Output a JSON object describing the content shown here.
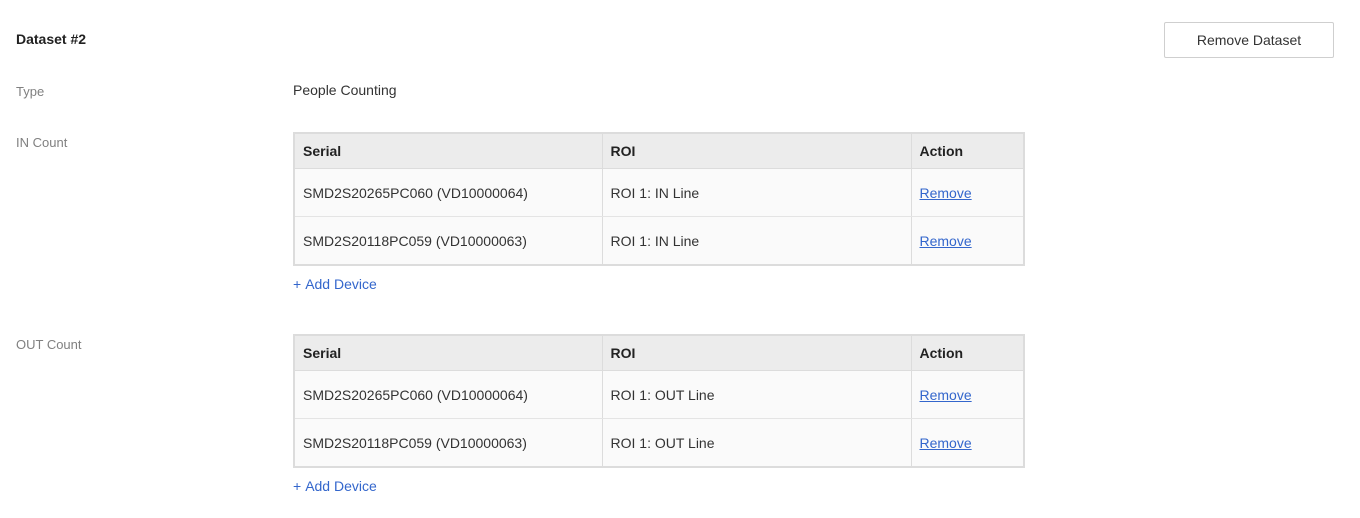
{
  "dataset": {
    "title": "Dataset #2",
    "remove_button": "Remove Dataset"
  },
  "type": {
    "label": "Type",
    "value": "People Counting"
  },
  "table_headers": {
    "serial": "Serial",
    "roi": "ROI",
    "action": "Action"
  },
  "in_count": {
    "label": "IN Count",
    "rows": [
      {
        "serial": "SMD2S20265PC060 (VD10000064)",
        "roi": "ROI 1: IN Line",
        "action": "Remove"
      },
      {
        "serial": "SMD2S20118PC059 (VD10000063)",
        "roi": "ROI 1: IN Line",
        "action": "Remove"
      }
    ],
    "add_device_plus": "+",
    "add_device_label": "Add Device"
  },
  "out_count": {
    "label": "OUT Count",
    "rows": [
      {
        "serial": "SMD2S20265PC060 (VD10000064)",
        "roi": "ROI 1: OUT Line",
        "action": "Remove"
      },
      {
        "serial": "SMD2S20118PC059 (VD10000063)",
        "roi": "ROI 1: OUT Line",
        "action": "Remove"
      }
    ],
    "add_device_plus": "+",
    "add_device_label": "Add Device"
  },
  "colors": {
    "link": "#3366cc",
    "header_bg": "#ececec",
    "row_bg": "#fafafa",
    "label_text": "#808080"
  }
}
